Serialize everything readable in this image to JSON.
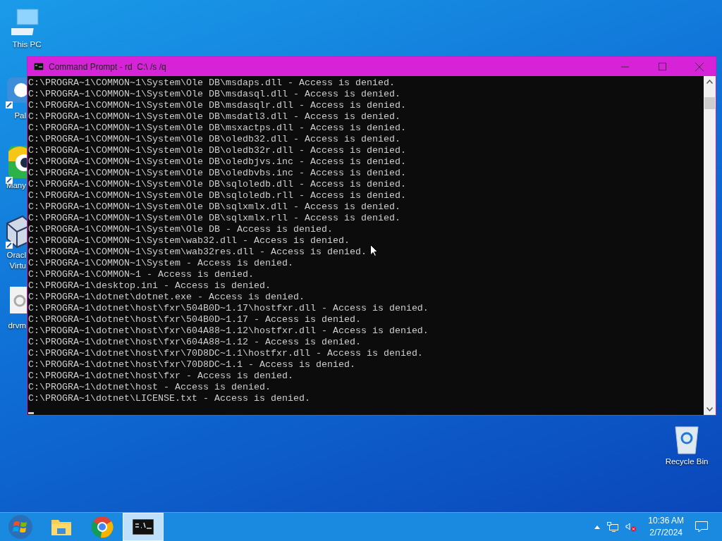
{
  "desktop_icons": [
    {
      "label": "This PC",
      "kind": "computer"
    },
    {
      "label": "Pal",
      "kind": "pal"
    },
    {
      "label": "Many",
      "kind": "many"
    },
    {
      "label": "Oracl Virtu",
      "kind": "box"
    },
    {
      "label": "drvm",
      "kind": "setup"
    }
  ],
  "recycle_bin": {
    "label": "Recycle Bin"
  },
  "window": {
    "title": "Command Prompt - rd  C:\\ /s /q",
    "active": true,
    "lines": [
      "C:\\PROGRA~1\\COMMON~1\\System\\Ole DB\\msdaps.dll - Access is denied.",
      "C:\\PROGRA~1\\COMMON~1\\System\\Ole DB\\msdasql.dll - Access is denied.",
      "C:\\PROGRA~1\\COMMON~1\\System\\Ole DB\\msdasqlr.dll - Access is denied.",
      "C:\\PROGRA~1\\COMMON~1\\System\\Ole DB\\msdatl3.dll - Access is denied.",
      "C:\\PROGRA~1\\COMMON~1\\System\\Ole DB\\msxactps.dll - Access is denied.",
      "C:\\PROGRA~1\\COMMON~1\\System\\Ole DB\\oledb32.dll - Access is denied.",
      "C:\\PROGRA~1\\COMMON~1\\System\\Ole DB\\oledb32r.dll - Access is denied.",
      "C:\\PROGRA~1\\COMMON~1\\System\\Ole DB\\oledbjvs.inc - Access is denied.",
      "C:\\PROGRA~1\\COMMON~1\\System\\Ole DB\\oledbvbs.inc - Access is denied.",
      "C:\\PROGRA~1\\COMMON~1\\System\\Ole DB\\sqloledb.dll - Access is denied.",
      "C:\\PROGRA~1\\COMMON~1\\System\\Ole DB\\sqloledb.rll - Access is denied.",
      "C:\\PROGRA~1\\COMMON~1\\System\\Ole DB\\sqlxmlx.dll - Access is denied.",
      "C:\\PROGRA~1\\COMMON~1\\System\\Ole DB\\sqlxmlx.rll - Access is denied.",
      "C:\\PROGRA~1\\COMMON~1\\System\\Ole DB - Access is denied.",
      "C:\\PROGRA~1\\COMMON~1\\System\\wab32.dll - Access is denied.",
      "C:\\PROGRA~1\\COMMON~1\\System\\wab32res.dll - Access is denied.",
      "C:\\PROGRA~1\\COMMON~1\\System - Access is denied.",
      "C:\\PROGRA~1\\COMMON~1 - Access is denied.",
      "C:\\PROGRA~1\\desktop.ini - Access is denied.",
      "C:\\PROGRA~1\\dotnet\\dotnet.exe - Access is denied.",
      "C:\\PROGRA~1\\dotnet\\host\\fxr\\504B0D~1.17\\hostfxr.dll - Access is denied.",
      "C:\\PROGRA~1\\dotnet\\host\\fxr\\504B0D~1.17 - Access is denied.",
      "C:\\PROGRA~1\\dotnet\\host\\fxr\\604A88~1.12\\hostfxr.dll - Access is denied.",
      "C:\\PROGRA~1\\dotnet\\host\\fxr\\604A88~1.12 - Access is denied.",
      "C:\\PROGRA~1\\dotnet\\host\\fxr\\70D8DC~1.1\\hostfxr.dll - Access is denied.",
      "C:\\PROGRA~1\\dotnet\\host\\fxr\\70D8DC~1.1 - Access is denied.",
      "C:\\PROGRA~1\\dotnet\\host\\fxr - Access is denied.",
      "C:\\PROGRA~1\\dotnet\\host - Access is denied.",
      "C:\\PROGRA~1\\dotnet\\LICENSE.txt - Access is denied."
    ]
  },
  "taskbar": {
    "apps": [
      {
        "kind": "start",
        "selected": false
      },
      {
        "kind": "explorer",
        "selected": false
      },
      {
        "kind": "chrome",
        "selected": false
      },
      {
        "kind": "console",
        "selected": true
      }
    ],
    "tray": {
      "muted": true,
      "time": "10:36 AM",
      "date": "2/7/2024"
    }
  }
}
